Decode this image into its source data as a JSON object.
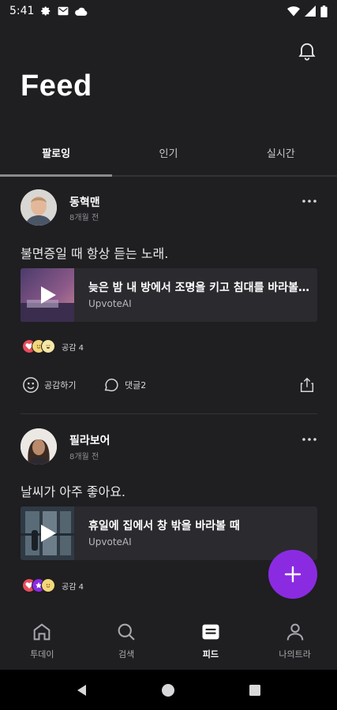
{
  "status_bar": {
    "time": "5:41"
  },
  "header": {
    "title": "Feed"
  },
  "tabs": [
    {
      "label": "팔로잉"
    },
    {
      "label": "인기"
    },
    {
      "label": "실시간"
    }
  ],
  "posts": [
    {
      "author": "동혁맨",
      "time": "8개월 전",
      "text": "불면증일 때 항상 듣는 노래.",
      "card_title": "늦은 밤 내 방에서 조명을 키고 침대를 바라볼 때",
      "card_source": "UpvoteAI",
      "reaction_count": "공감 4",
      "actions": {
        "empathize": "공감하기",
        "comment": "댓글2"
      }
    },
    {
      "author": "필라보어",
      "time": "8개월 전",
      "text": "날씨가 아주 좋아요.",
      "card_title": "휴일에 집에서 창 밖을 바라볼 때",
      "card_source": "UpvoteAI",
      "reaction_count": "공감 4"
    }
  ],
  "bottom_nav": [
    {
      "label": "투데이",
      "icon": "home-icon"
    },
    {
      "label": "검색",
      "icon": "search-icon"
    },
    {
      "label": "피드",
      "icon": "feed-icon"
    },
    {
      "label": "나의트라",
      "icon": "profile-icon"
    }
  ],
  "colors": {
    "accent": "#8a2be2",
    "background": "#1f1e21",
    "card": "#2b2a2f"
  }
}
